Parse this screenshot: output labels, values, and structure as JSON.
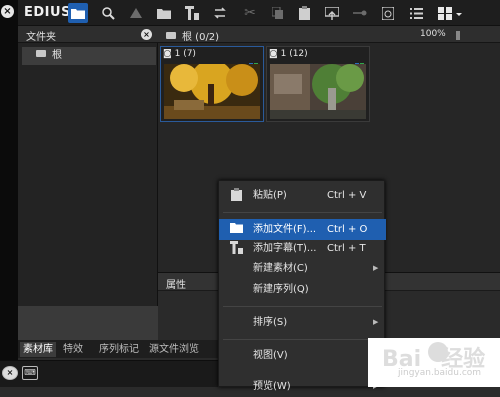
{
  "toolbar": {
    "logo": "EDIUS",
    "icons": [
      "folder-icon",
      "search-icon",
      "up-icon",
      "open-folder-icon",
      "title-icon",
      "swap-icon",
      "cut-icon",
      "copy-icon",
      "paste-icon",
      "export-icon",
      "gear-icon",
      "delete-icon",
      "list-icon",
      "grid-icon"
    ]
  },
  "folder_panel": {
    "title": "文件夹",
    "root_label": "根"
  },
  "content_panel": {
    "path": "根 (0/2)",
    "zoom": "100%",
    "clips": [
      {
        "label": "1 (7)",
        "colors": [
          "#d4a017",
          "#8a5a10"
        ]
      },
      {
        "label": "1 (12)",
        "colors": [
          "#5a8a3a",
          "#6a5a4a"
        ]
      }
    ]
  },
  "attributes_panel": {
    "title": "属性"
  },
  "context_menu": {
    "items": [
      {
        "label": "粘贴(P)",
        "shortcut": "Ctrl + V",
        "icon": "clipboard-icon",
        "highlight": false,
        "submenu": false
      },
      {
        "label": "添加文件(F)...",
        "shortcut": "Ctrl + O",
        "icon": "folder-icon",
        "highlight": true,
        "submenu": false
      },
      {
        "label": "添加字幕(T)...",
        "shortcut": "Ctrl + T",
        "icon": "title-icon",
        "highlight": false,
        "submenu": false
      },
      {
        "label": "新建素材(C)",
        "shortcut": "",
        "icon": "",
        "highlight": false,
        "submenu": true
      },
      {
        "label": "新建序列(Q)",
        "shortcut": "",
        "icon": "",
        "highlight": false,
        "submenu": false
      },
      {
        "label": "排序(S)",
        "shortcut": "",
        "icon": "",
        "highlight": false,
        "submenu": true
      },
      {
        "label": "视图(V)",
        "shortcut": "",
        "icon": "",
        "highlight": false,
        "submenu": true
      },
      {
        "label": "预览(W)",
        "shortcut": "",
        "icon": "",
        "highlight": false,
        "submenu": true
      }
    ]
  },
  "bottom_tabs": [
    "素材库",
    "特效",
    "序列标记",
    "源文件浏览"
  ],
  "watermark": {
    "text": "Bai",
    "suffix": "经验",
    "sub": "jingyan.baidu.com"
  },
  "colors": {
    "accent": "#1f5fb0",
    "background": "#2b2b2b"
  }
}
